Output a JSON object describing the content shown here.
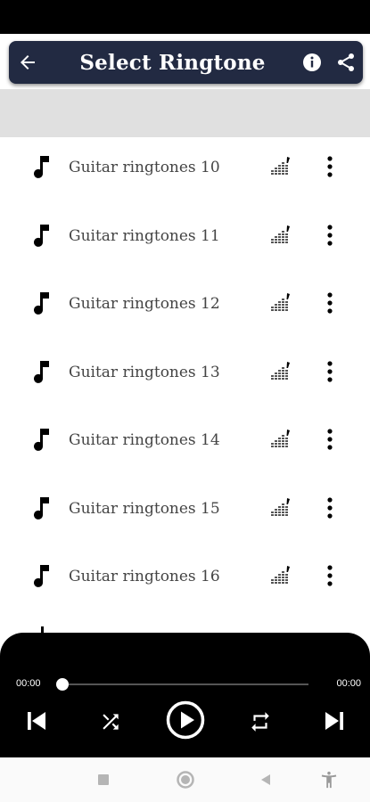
{
  "toolbar": {
    "title": "Select Ringtone",
    "icons": {
      "back": "arrow-left-icon",
      "info": "info-icon",
      "share": "share-icon"
    }
  },
  "ringtones": [
    {
      "label": "Guitar ringtones 10"
    },
    {
      "label": "Guitar ringtones 11"
    },
    {
      "label": "Guitar ringtones 12"
    },
    {
      "label": "Guitar ringtones 13"
    },
    {
      "label": "Guitar ringtones 14"
    },
    {
      "label": "Guitar ringtones 15"
    },
    {
      "label": "Guitar ringtones 16"
    }
  ],
  "row_icons": {
    "leading": "music-note-icon",
    "set": "ringtone-equalizer-icon",
    "menu": "more-vertical-icon"
  },
  "player": {
    "current_time": "00:00",
    "total_time": "00:00",
    "progress": 0,
    "icons": [
      "skip-previous-icon",
      "shuffle-icon",
      "play-circle-icon",
      "repeat-icon",
      "skip-next-icon"
    ]
  },
  "system_nav": {
    "icons": [
      "recents-square-icon",
      "home-circle-icon",
      "back-triangle-icon",
      "accessibility-icon"
    ]
  },
  "colors": {
    "toolbar_bg": "#222a42",
    "player_bg": "#000000",
    "strip_bg": "#e0e0e0",
    "text": "#444444"
  }
}
